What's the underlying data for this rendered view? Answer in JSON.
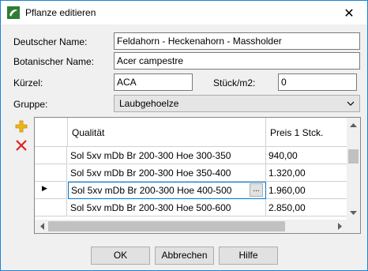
{
  "window": {
    "title": "Pflanze editieren",
    "close_symbol": "✕"
  },
  "form": {
    "deutscher_name_label": "Deutscher Name:",
    "deutscher_name_value": "Feldahorn - Heckenahorn - Massholder",
    "botanischer_name_label": "Botanischer Name:",
    "botanischer_name_value": "Acer campestre",
    "kuerzel_label": "Kürzel:",
    "kuerzel_value": "ACA",
    "stueck_label": "Stück/m2:",
    "stueck_value": "0",
    "gruppe_label": "Gruppe:",
    "gruppe_value": "Laubgehoelze"
  },
  "grid": {
    "headers": [
      "Qualität",
      "Preis 1 Stck."
    ],
    "rows": [
      {
        "qualitaet": "Sol 5xv mDb Br 200-300 Hoe 300-350",
        "preis": "940,00"
      },
      {
        "qualitaet": "Sol 5xv mDb Br 200-300 Hoe 350-400",
        "preis": "1.320,00"
      },
      {
        "qualitaet": "Sol 5xv mDb Br 200-300 Hoe 400-500",
        "preis": "1.960,00"
      },
      {
        "qualitaet": "Sol 5xv mDb Br 200-300 Hoe 500-600",
        "preis": "2.850,00"
      }
    ],
    "selected_row_index": 2,
    "row_indicator": "▶",
    "ellipsis_label": "..."
  },
  "buttons": {
    "ok": "OK",
    "cancel": "Abbrechen",
    "help": "Hilfe"
  },
  "icons": {
    "app": "plant-app-icon",
    "add": "plus-icon",
    "delete": "x-icon",
    "combo_arrow": "chevron-down-icon"
  },
  "colors": {
    "accent": "#0078d7",
    "add_icon": "#f2b418",
    "delete_icon": "#e02020",
    "window_border": "#1883d7"
  }
}
